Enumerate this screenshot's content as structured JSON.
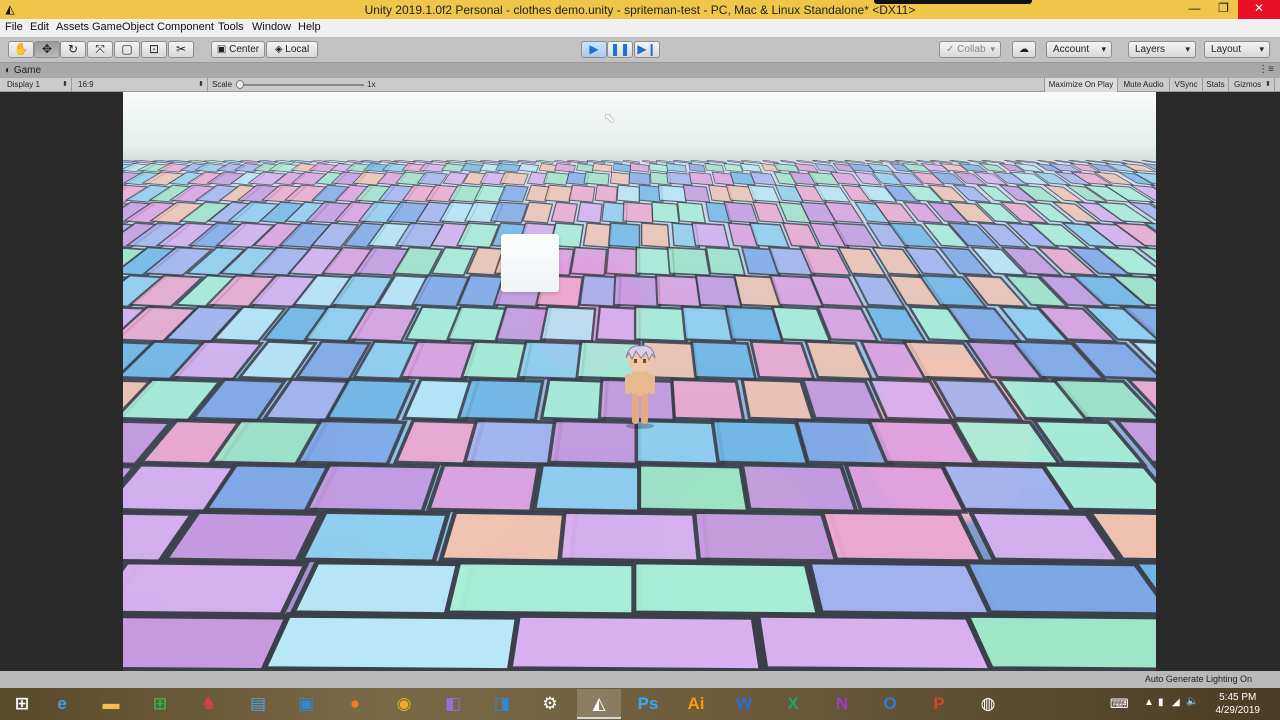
{
  "window": {
    "title": "Unity 2019.1.0f2 Personal - clothes demo.unity - spriteman-test - PC, Mac & Linux Standalone* <DX11>",
    "minimize": "—",
    "maximize": "❐",
    "close": "✕"
  },
  "menu": [
    "File",
    "Edit",
    "Assets",
    "GameObject",
    "Component",
    "Tools",
    "Window",
    "Help"
  ],
  "toolbar": {
    "tools": [
      "hand-tool-icon",
      "move-tool-icon",
      "rotate-tool-icon",
      "scale-tool-icon",
      "rect-tool-icon",
      "transform-tool-icon",
      "custom-tool-icon"
    ],
    "pivot_label": "Center",
    "space_label": "Local",
    "collab_label": "Collab",
    "account_label": "Account",
    "layers_label": "Layers",
    "layout_label": "Layout"
  },
  "tab": {
    "label": "Game"
  },
  "gamebar": {
    "display": "Display 1",
    "aspect": "16:9",
    "scale_label": "Scale",
    "scale_value": "1x",
    "scale_fraction": 0.0,
    "maximize_on_play": "Maximize On Play",
    "mute_audio": "Mute Audio",
    "vsync": "VSync",
    "stats": "Stats",
    "gizmos": "Gizmos"
  },
  "status": {
    "text": "Auto Generate Lighting On"
  },
  "taskbar": {
    "items": [
      {
        "name": "windows-start-icon",
        "glyph": "⊞",
        "color": "#ffffff"
      },
      {
        "name": "internet-explorer-icon",
        "glyph": "e",
        "color": "#3fa0e8"
      },
      {
        "name": "file-explorer-icon",
        "glyph": "▬",
        "color": "#f2c34a"
      },
      {
        "name": "store-icon",
        "glyph": "⊞",
        "color": "#2fb34a"
      },
      {
        "name": "app-icon-red",
        "glyph": "♞",
        "color": "#d84040"
      },
      {
        "name": "notepad-icon",
        "glyph": "▤",
        "color": "#5aa0e0"
      },
      {
        "name": "remote-desktop-icon",
        "glyph": "▣",
        "color": "#2a8ad8"
      },
      {
        "name": "firefox-icon",
        "glyph": "●",
        "color": "#f07a20"
      },
      {
        "name": "chrome-icon",
        "glyph": "◉",
        "color": "#e8b020"
      },
      {
        "name": "visual-studio-icon",
        "glyph": "◧",
        "color": "#9a6ad8"
      },
      {
        "name": "vscode-icon",
        "glyph": "◨",
        "color": "#2a8ad8"
      },
      {
        "name": "steam-icon",
        "glyph": "⚙",
        "color": "#ffffff"
      },
      {
        "name": "unity-icon",
        "glyph": "◭",
        "color": "#ffffff"
      },
      {
        "name": "photoshop-icon",
        "glyph": "Ps",
        "color": "#31a8ff"
      },
      {
        "name": "illustrator-icon",
        "glyph": "Ai",
        "color": "#ff9a00"
      },
      {
        "name": "word-icon",
        "glyph": "W",
        "color": "#2b6cd6"
      },
      {
        "name": "excel-icon",
        "glyph": "X",
        "color": "#21a366"
      },
      {
        "name": "onenote-icon",
        "glyph": "N",
        "color": "#9a3fc0"
      },
      {
        "name": "outlook-icon",
        "glyph": "O",
        "color": "#2b7cd6"
      },
      {
        "name": "powerpoint-icon",
        "glyph": "P",
        "color": "#d24726"
      },
      {
        "name": "obs-icon",
        "glyph": "◍",
        "color": "#ffffff"
      }
    ],
    "time": "5:45 PM",
    "date": "4/29/2019"
  },
  "colors": {
    "titlebar": "#f0c64a",
    "play_accent": "#1a6fd8",
    "close_red": "#e81123"
  }
}
